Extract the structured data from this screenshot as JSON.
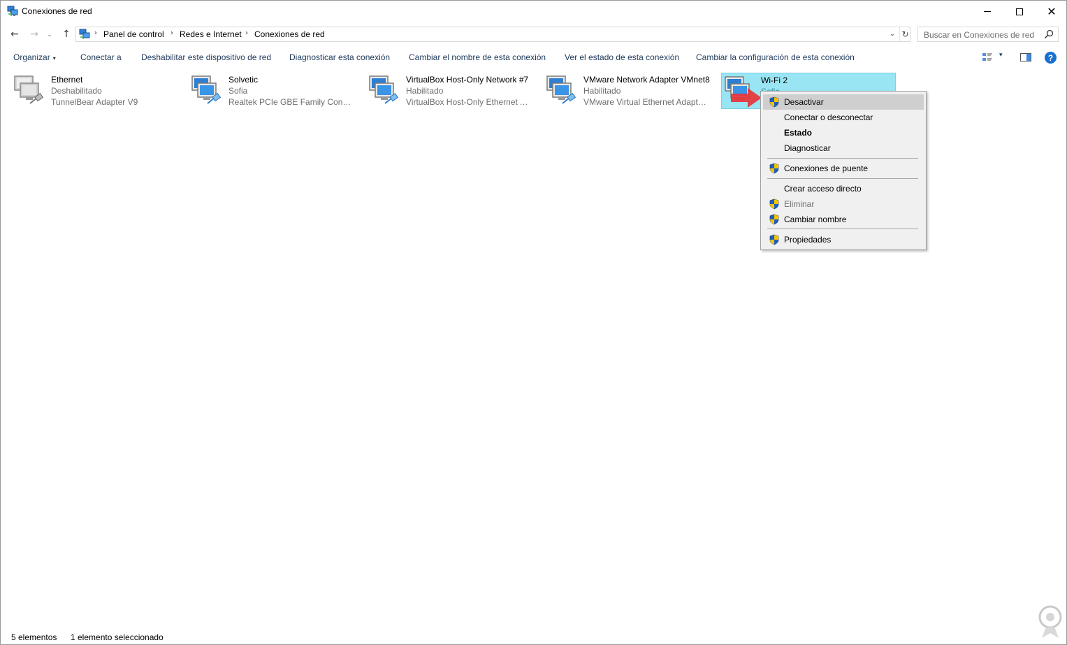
{
  "window": {
    "title": "Conexiones de red",
    "controls": {
      "minimize": "minimize-icon",
      "maximize": "maximize-icon",
      "close": "✕"
    }
  },
  "nav": {
    "back": "←",
    "forward": "→",
    "recent": "⌄",
    "up": "↑"
  },
  "address": {
    "crumbs": [
      "Panel de control",
      "Redes e Internet",
      "Conexiones de red"
    ],
    "separator": "›",
    "dropdown": "⌄",
    "refresh": "↻"
  },
  "search": {
    "placeholder": "Buscar en Conexiones de red"
  },
  "commands": {
    "organize": "Organizar",
    "organize_arrow": "▾",
    "connect_to": "Conectar a",
    "disable_device": "Deshabilitar este dispositivo de red",
    "diagnose": "Diagnosticar esta conexión",
    "rename": "Cambiar el nombre de esta conexión",
    "view_status": "Ver el estado de esta conexión",
    "change_settings": "Cambiar la configuración de esta conexión",
    "view_arrow": "▾",
    "help": "?"
  },
  "connections": [
    {
      "name": "Ethernet",
      "status": "Deshabilitado",
      "device": "TunnelBear Adapter V9",
      "state": "disabled"
    },
    {
      "name": "Solvetic",
      "status": "Sofia",
      "device": "Realtek PCIe GBE Family Controller",
      "state": "enabled"
    },
    {
      "name": "VirtualBox Host-Only Network #7",
      "status": "Habilitado",
      "device": "VirtualBox Host-Only Ethernet Ad...",
      "state": "enabled"
    },
    {
      "name": "VMware Network Adapter VMnet8",
      "status": "Habilitado",
      "device": "VMware Virtual Ethernet Adapter ...",
      "state": "enabled"
    },
    {
      "name": "Wi-Fi 2",
      "status": "Sofia",
      "device": "",
      "state": "selected"
    }
  ],
  "context_menu": {
    "items": [
      {
        "label": "Desactivar",
        "shield": true,
        "bold": false,
        "disabled": false,
        "highlight": true
      },
      {
        "label": "Conectar o desconectar",
        "shield": false,
        "bold": false,
        "disabled": false,
        "highlight": false
      },
      {
        "label": "Estado",
        "shield": false,
        "bold": true,
        "disabled": false,
        "highlight": false
      },
      {
        "label": "Diagnosticar",
        "shield": false,
        "bold": false,
        "disabled": false,
        "highlight": false
      },
      {
        "label": "Conexiones de puente",
        "shield": true,
        "bold": false,
        "disabled": false,
        "highlight": false
      },
      {
        "label": "Crear acceso directo",
        "shield": false,
        "bold": false,
        "disabled": false,
        "highlight": false
      },
      {
        "label": "Eliminar",
        "shield": true,
        "bold": false,
        "disabled": true,
        "highlight": false
      },
      {
        "label": "Cambiar nombre",
        "shield": true,
        "bold": false,
        "disabled": false,
        "highlight": false
      },
      {
        "label": "Propiedades",
        "shield": true,
        "bold": false,
        "disabled": false,
        "highlight": false
      }
    ]
  },
  "status": {
    "count": "5 elementos",
    "selected": "1 elemento seleccionado"
  },
  "colors": {
    "selection": "#99e5f3",
    "command_text": "#1e395b",
    "menu_bg": "#f0f0f0",
    "menu_highlight": "#cfcfcf",
    "arrow": "#e8343a"
  }
}
